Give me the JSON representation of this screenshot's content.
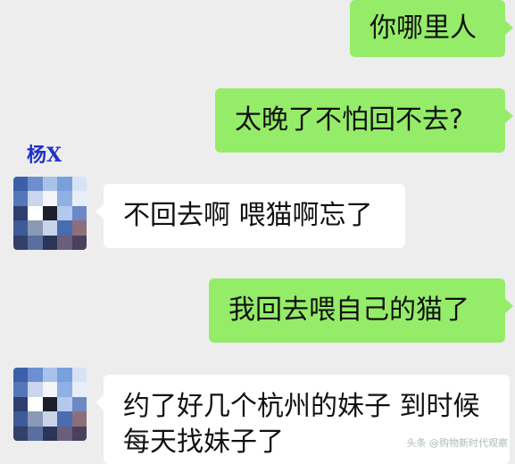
{
  "chat": {
    "sender_name": "杨X",
    "messages": [
      {
        "side": "out",
        "text": "你哪里人"
      },
      {
        "side": "out",
        "text": "太晚了不怕回不去?"
      },
      {
        "side": "in",
        "text": "不回去啊 喂猫啊忘了"
      },
      {
        "side": "out",
        "text": "我回去喂自己的猫了"
      },
      {
        "side": "in",
        "text_line1": "约了好几个杭州的妹子 到时候",
        "text_line2": "每天找妹子了"
      }
    ]
  },
  "watermark": "头条 @购物新时代观察",
  "colors": {
    "background": "#ededed",
    "outgoing_bubble": "#95ec69",
    "incoming_bubble": "#ffffff",
    "sender_name": "#1d33c9"
  }
}
